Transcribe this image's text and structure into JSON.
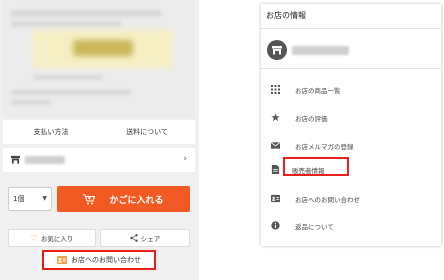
{
  "left": {
    "payment_method": "支払い方法",
    "shipping_info": "送料について",
    "quantity": "1個",
    "add_to_cart": "かごに入れる",
    "favorite": "お気に入り",
    "share": "シェア",
    "contact_shop": "お店へのお問い合わせ"
  },
  "right": {
    "title": "お店の情報",
    "menu": [
      {
        "label": "お店の商品一覧",
        "icon": "grid-icon"
      },
      {
        "label": "お店の評価",
        "icon": "star-icon"
      },
      {
        "label": "お店メルマガの登録",
        "icon": "mail-icon"
      },
      {
        "label": "販売者情報",
        "icon": "document-icon",
        "highlighted": true
      },
      {
        "label": "お店へのお問い合わせ",
        "icon": "contact-card-icon"
      },
      {
        "label": "返品について",
        "icon": "info-icon"
      }
    ]
  },
  "colors": {
    "cart_button": "#f15a22",
    "highlight_border": "#e8211d",
    "heart": "#f0a24a"
  }
}
